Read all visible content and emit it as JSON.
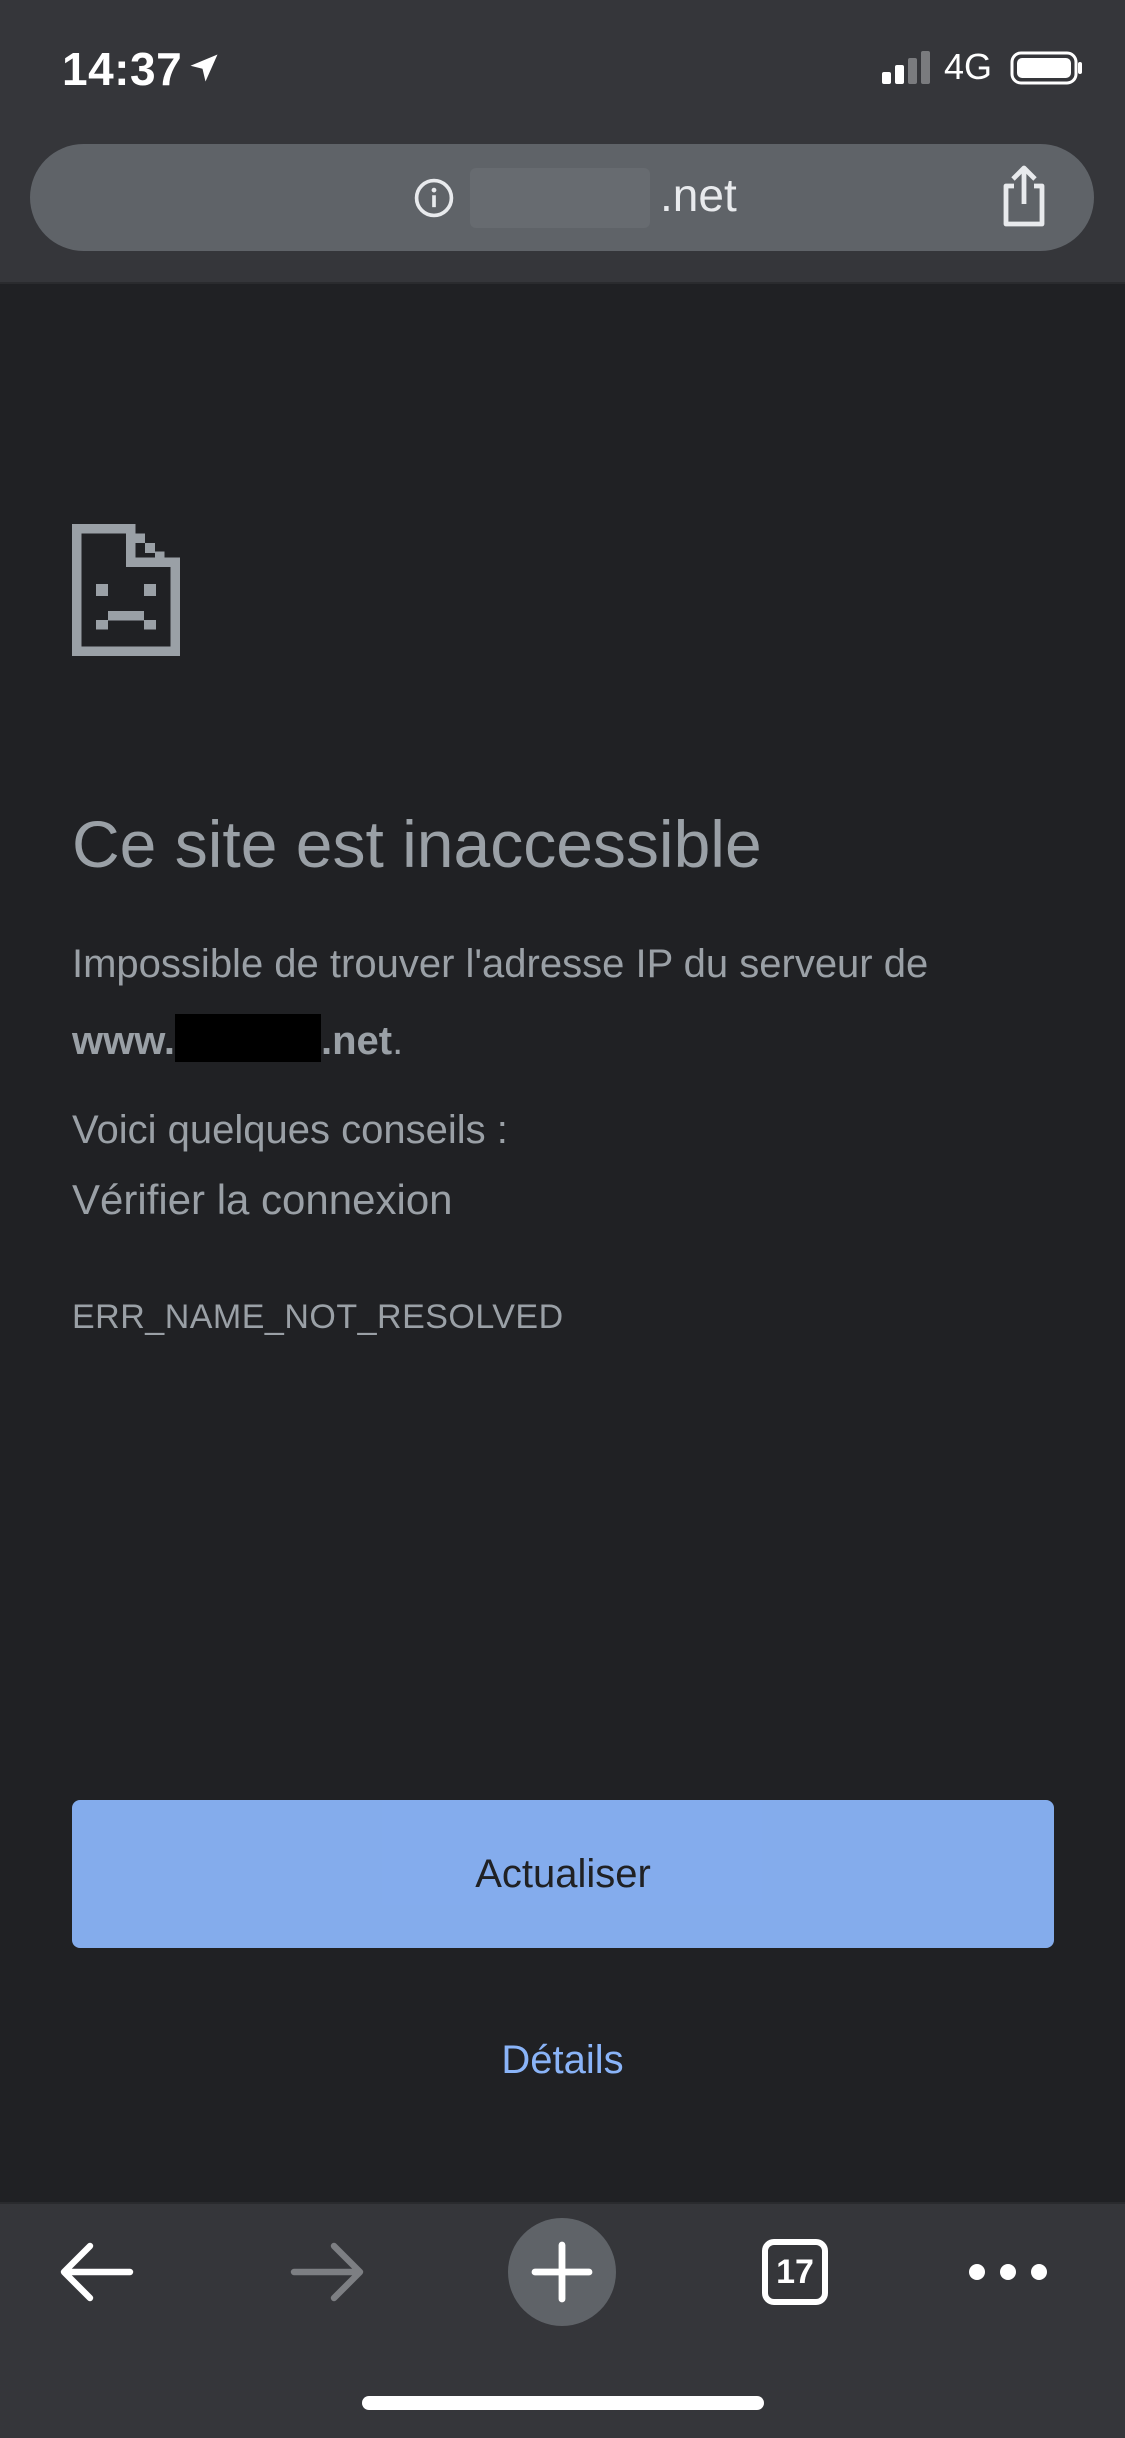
{
  "status_bar": {
    "time": "14:37",
    "network": "4G"
  },
  "url_bar": {
    "domain": ".net"
  },
  "error_page": {
    "title": "Ce site est inaccessible",
    "description": "Impossible de trouver l'adresse IP du serveur de",
    "host_prefix": "www.",
    "host_suffix": ".net",
    "host_period": ".",
    "tips_heading": "Voici quelques conseils :",
    "tips": [
      "Vérifier la connexion"
    ],
    "error_code": "ERR_NAME_NOT_RESOLVED",
    "reload_label": "Actualiser",
    "details_label": "Détails"
  },
  "toolbar": {
    "tab_count": "17"
  },
  "colors": {
    "page_background": "#202124",
    "chrome_background": "#35363a",
    "text": "#9aa0a6",
    "accent": "#8ab4f8"
  },
  "icons": [
    "location-arrow-icon",
    "signal-icon",
    "battery-icon",
    "info-icon",
    "share-icon",
    "sad-page-icon",
    "back-arrow-icon",
    "forward-arrow-icon",
    "plus-icon",
    "tabs-icon",
    "more-icon"
  ]
}
